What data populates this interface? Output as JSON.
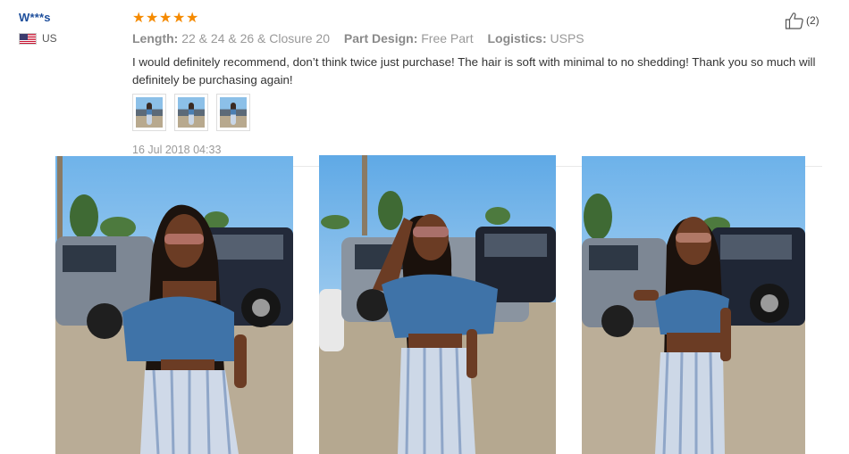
{
  "reviewer": {
    "name": "W***s",
    "country": "US",
    "flag_icon": "us-flag-icon"
  },
  "rating": {
    "stars": 5,
    "max": 5,
    "star_color": "#f58a00"
  },
  "attributes": [
    {
      "key": "Length:",
      "value": "22 & 24 & 26 & Closure 20"
    },
    {
      "key": "Part Design:",
      "value": "Free Part"
    },
    {
      "key": "Logistics:",
      "value": "USPS"
    }
  ],
  "helpful": {
    "icon": "thumbs-up-icon",
    "count": "(2)"
  },
  "review": {
    "text": "I would definitely recommend, don’t think twice just purchase! The hair is soft with minimal to no shedding! Thank you so much will definitely be purchasing again!",
    "date": "16 Jul 2018 04:33"
  },
  "thumbnails": [
    "review-photo-1",
    "review-photo-2",
    "review-photo-3"
  ],
  "colors": {
    "username": "#1e4f9c",
    "text": "#333333",
    "muted": "#999999"
  }
}
